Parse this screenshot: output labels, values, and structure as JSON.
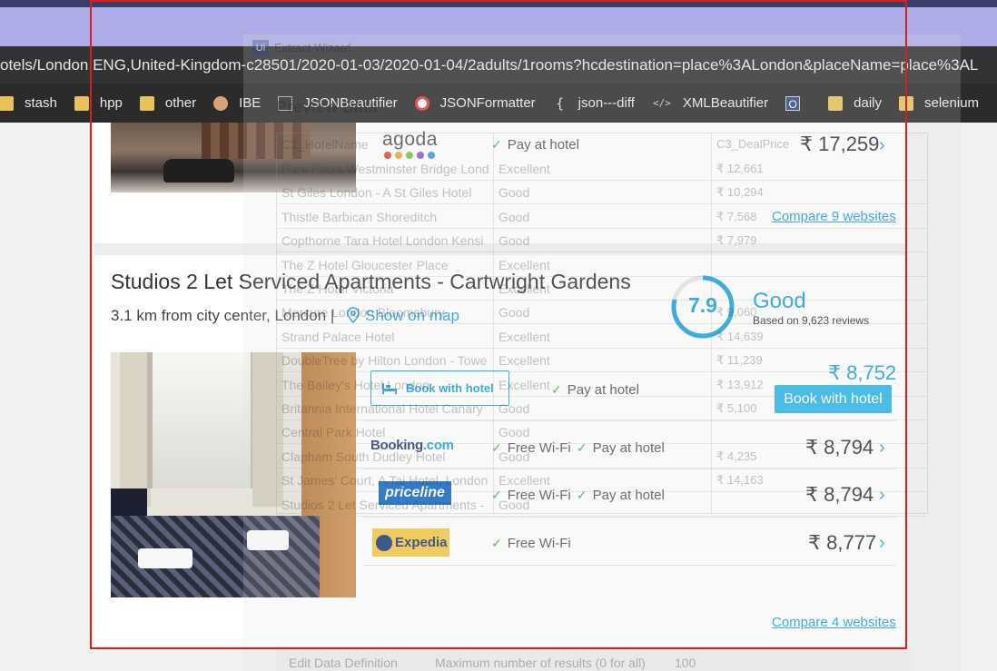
{
  "browser": {
    "url": "otels/London,ENG,United-Kingdom-c28501/2020-01-03/2020-01-04/2adults/1rooms?hcdestination=place%3ALondon&placeName=place%3AL",
    "bookmarks": [
      {
        "label": "stash",
        "icon": "folder-icon"
      },
      {
        "label": "hpp",
        "icon": "folder-icon"
      },
      {
        "label": "other",
        "icon": "folder-icon"
      },
      {
        "label": "IBE",
        "icon": "ibe-icon"
      },
      {
        "label": "JSONBeautifier",
        "icon": "json-beautifier-icon"
      },
      {
        "label": "JSONFormatter",
        "icon": "opera-icon"
      },
      {
        "label": "json---diff",
        "icon": "brace-icon"
      },
      {
        "label": "XMLBeautifier",
        "icon": "xml-icon"
      },
      {
        "label": "",
        "icon": "o-icon"
      },
      {
        "label": "daily",
        "icon": "folder-icon"
      },
      {
        "label": "selenium",
        "icon": "folder-icon"
      }
    ]
  },
  "card1": {
    "provider": "agoda",
    "feature": "Pay at hotel",
    "price": "₹ 17,259",
    "compare_link": "Compare 9 websites"
  },
  "card2": {
    "title": "Studios 2 Let Serviced Apartments - Cartwright Gardens",
    "distance": "3.1 km from city center, London |",
    "map_link": "Show on map",
    "rating": {
      "score": "7.9",
      "word": "Good",
      "reviews": "Based on 9,623 reviews",
      "fill_fraction": 0.79
    },
    "hotel_offer": {
      "button": "Book with hotel",
      "feature": "Pay at hotel",
      "price": "₹ 8,752",
      "cta": "Book with hotel"
    },
    "offers": [
      {
        "provider": "Booking.com",
        "features": [
          "Free Wi-Fi",
          "Pay at hotel"
        ],
        "price": "₹ 8,794"
      },
      {
        "provider": "priceline",
        "features": [
          "Free Wi-Fi",
          "Pay at hotel"
        ],
        "price": "₹ 8,794"
      },
      {
        "provider": "Expedia",
        "features": [
          "Free Wi-Fi"
        ],
        "price": "₹ 8,777"
      }
    ],
    "compare_link": "Compare 4 websites"
  },
  "overlay": {
    "window_title": "Extract Wizard",
    "subtitle": "Preview Data",
    "columns": [
      "C1_HotelName",
      "C3_DealPrice"
    ],
    "rows": [
      [
        "Park Plaza Westminster Bridge Lond",
        "Excellent",
        "₹ 12,661"
      ],
      [
        "St Giles London - A St Giles Hotel",
        "Good",
        "₹ 10,294"
      ],
      [
        "Thistle Barbican Shoreditch",
        "Good",
        "₹ 7,568"
      ],
      [
        "Copthorne Tara Hotel London Kensi",
        "Good",
        "₹ 7,979"
      ],
      [
        "The Z Hotel Gloucester Place",
        "Excellent",
        ""
      ],
      [
        "The Z Hotel Victoria",
        "Excellent",
        ""
      ],
      [
        "Mercure London Bloomsbury",
        "Good",
        "₹ 9,060"
      ],
      [
        "Strand Palace Hotel",
        "Excellent",
        "₹ 14,639"
      ],
      [
        "DoubleTree by Hilton London - Towe",
        "Excellent",
        "₹ 11,239"
      ],
      [
        "The Bailey's Hotel London",
        "Excellent",
        "₹ 13,912"
      ],
      [
        "Britannia International Hotel Canary",
        "Good",
        "₹ 5,100"
      ],
      [
        "Central Park Hotel",
        "Good",
        ""
      ],
      [
        "Clapham South Dudley Hotel",
        "Good",
        "₹ 4,235"
      ],
      [
        "St James' Court, A Taj Hotel, London",
        "Excellent",
        "₹ 14,163"
      ],
      [
        "Studios 2 Let Serviced Apartments -",
        "Good",
        ""
      ]
    ],
    "bottom": {
      "edit": "Edit Data Definition",
      "max_label": "Maximum number of results (0 for all)",
      "max_value": "100"
    }
  }
}
